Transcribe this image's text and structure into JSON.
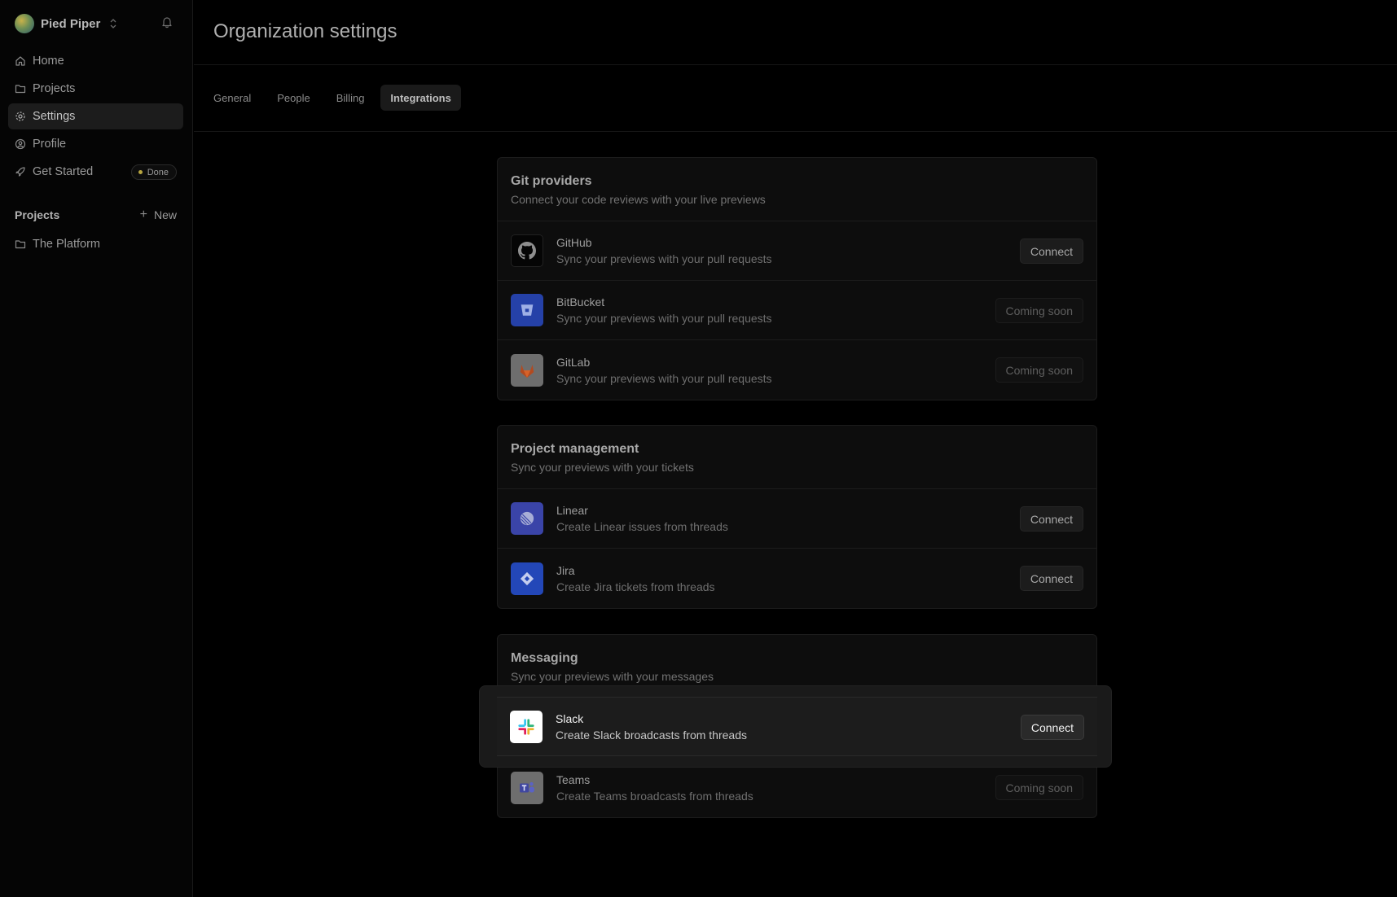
{
  "sidebar": {
    "org_name": "Pied Piper",
    "nav": [
      {
        "label": "Home",
        "icon": "home-icon"
      },
      {
        "label": "Projects",
        "icon": "folder-icon"
      },
      {
        "label": "Settings",
        "icon": "gear-icon"
      },
      {
        "label": "Profile",
        "icon": "user-circle-icon"
      },
      {
        "label": "Get Started",
        "icon": "rocket-icon",
        "badge": "Done"
      }
    ],
    "active_nav": "Settings",
    "projects_title": "Projects",
    "new_label": "New",
    "projects": [
      {
        "label": "The Platform",
        "icon": "folder-icon"
      }
    ]
  },
  "main": {
    "title": "Organization settings",
    "tabs": [
      "General",
      "People",
      "Billing",
      "Integrations"
    ],
    "active_tab": "Integrations",
    "sections": [
      {
        "title": "Git providers",
        "subtitle": "Connect your code reviews with your live previews",
        "items": [
          {
            "name": "GitHub",
            "desc": "Sync your previews with your pull requests",
            "action": "Connect"
          },
          {
            "name": "BitBucket",
            "desc": "Sync your previews with your pull requests",
            "action": "Coming soon"
          },
          {
            "name": "GitLab",
            "desc": "Sync your previews with your pull requests",
            "action": "Coming soon"
          }
        ]
      },
      {
        "title": "Project management",
        "subtitle": "Sync your previews with your tickets",
        "items": [
          {
            "name": "Linear",
            "desc": "Create Linear issues from threads",
            "action": "Connect"
          },
          {
            "name": "Jira",
            "desc": "Create Jira tickets from threads",
            "action": "Connect"
          }
        ]
      },
      {
        "title": "Messaging",
        "subtitle": "Sync your previews with your messages",
        "items": [
          {
            "name": "Slack",
            "desc": "Create Slack broadcasts from threads",
            "action": "Connect"
          },
          {
            "name": "Teams",
            "desc": "Create Teams broadcasts from threads",
            "action": "Coming soon"
          }
        ]
      }
    ]
  },
  "colors": {
    "background": "#000000",
    "card": "#0d0d0d",
    "bitbucket": "#2541a8",
    "linear": "#3a44a8",
    "jira": "#2347b8",
    "done_dot": "#b8a640"
  }
}
